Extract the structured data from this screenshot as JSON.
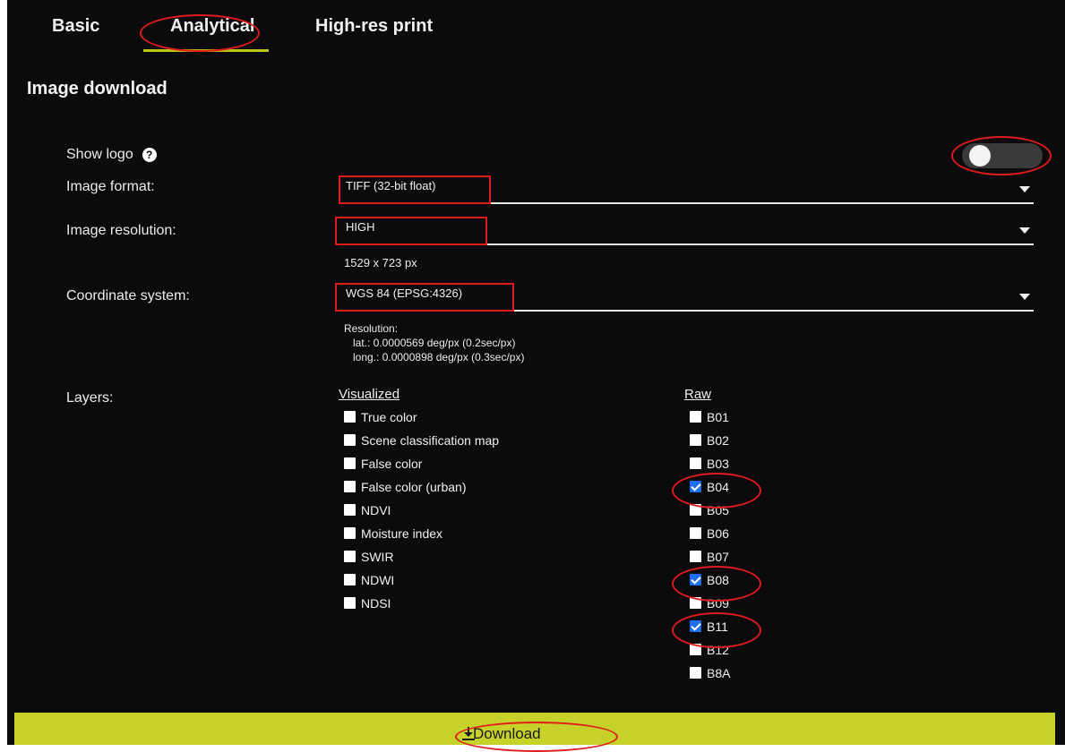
{
  "tabs": [
    {
      "label": "Basic"
    },
    {
      "label": "Analytical"
    },
    {
      "label": "High-res print"
    }
  ],
  "section_title": "Image download",
  "show_logo": {
    "label": "Show logo",
    "help_icon": "question-circle-icon",
    "enabled": false
  },
  "image_format": {
    "label": "Image format:",
    "value": "TIFF (32-bit float)"
  },
  "image_resolution": {
    "label": "Image resolution:",
    "value": "HIGH",
    "size_text": "1529 x 723 px"
  },
  "coordinate_system": {
    "label": "Coordinate system:",
    "value": "WGS 84 (EPSG:4326)"
  },
  "resolution": {
    "title": "Resolution:",
    "lat": "lat.: 0.0000569 deg/px (0.2sec/px)",
    "long": "long.: 0.0000898 deg/px (0.3sec/px)"
  },
  "layers": {
    "label": "Layers:",
    "visualized_header": "Visualized",
    "raw_header": "Raw",
    "visualized": [
      {
        "label": "True color",
        "checked": false
      },
      {
        "label": "Scene classification map",
        "checked": false
      },
      {
        "label": "False color",
        "checked": false
      },
      {
        "label": "False color (urban)",
        "checked": false
      },
      {
        "label": "NDVI",
        "checked": false
      },
      {
        "label": "Moisture index",
        "checked": false
      },
      {
        "label": "SWIR",
        "checked": false
      },
      {
        "label": "NDWI",
        "checked": false
      },
      {
        "label": "NDSI",
        "checked": false
      }
    ],
    "raw": [
      {
        "label": "B01",
        "checked": false
      },
      {
        "label": "B02",
        "checked": false
      },
      {
        "label": "B03",
        "checked": false
      },
      {
        "label": "B04",
        "checked": true
      },
      {
        "label": "B05",
        "checked": false
      },
      {
        "label": "B06",
        "checked": false
      },
      {
        "label": "B07",
        "checked": false
      },
      {
        "label": "B08",
        "checked": true
      },
      {
        "label": "B09",
        "checked": false
      },
      {
        "label": "B11",
        "checked": true
      },
      {
        "label": "B12",
        "checked": false
      },
      {
        "label": "B8A",
        "checked": false
      }
    ]
  },
  "download": {
    "label": "Download",
    "icon": "download-icon"
  },
  "colors": {
    "accent": "#c6d12a",
    "annotation": "#e01b1b",
    "checkbox_checked": "#1e6ff0",
    "background": "#0b0b0d"
  }
}
